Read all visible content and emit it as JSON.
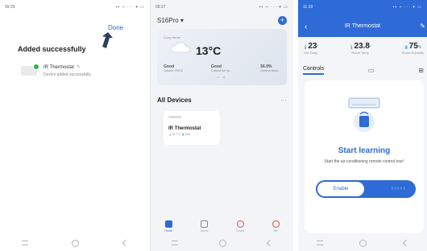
{
  "screen1": {
    "status_time": "09:29",
    "status_icons": "▪▪ ⌁ ··· ▾ ▭",
    "done_label": "Done",
    "title": "Added successfully",
    "device_name": "IR Thermostat",
    "device_subtitle": "Device added successfully",
    "colors": {
      "link": "#2f6bd6",
      "success": "#2db54a"
    }
  },
  "screen2": {
    "status_time": "09:27",
    "status_icons": "▪▪ ⌁ ··· ▾ ▭",
    "home_name": "S16Pro ▾",
    "weather": {
      "location": "Cozy Home",
      "temperature": "13°C",
      "stats": [
        {
          "value": "Good",
          "label": "Outdoor PM2.5"
        },
        {
          "value": "Good",
          "label": "Outdoor Air Qu..."
        },
        {
          "value": "56.0%",
          "label": "Outdoor Humi..."
        }
      ]
    },
    "all_devices_title": "All Devices",
    "card": {
      "name": "IR Thermostat",
      "stats": "🌡15.7°C  💧43%"
    },
    "tabs": [
      {
        "label": "Home",
        "active": true,
        "color": "#2f6bd6"
      },
      {
        "label": "Scene",
        "active": false,
        "color": "#7a8a9a"
      },
      {
        "label": "Smart",
        "active": false,
        "color": "#e04848"
      },
      {
        "label": "Me",
        "active": false,
        "color": "#e04848"
      }
    ]
  },
  "screen3": {
    "status_time": "11:19",
    "status_icons": "▪▪ ⌁ ··· ▾ ▭",
    "title": "IR Thermostat",
    "readings": [
      {
        "value": "23",
        "unit": "°",
        "label": "Out Temp"
      },
      {
        "value": "23.8",
        "unit": "°",
        "label": "Room Temp"
      },
      {
        "value": "75",
        "unit": "%",
        "label": "Room Humidity"
      }
    ],
    "tab_controls": "Controls",
    "learn_title": "Start learning",
    "learn_subtitle": "Start the air-conditioning remote control tour!",
    "enable_label": "Enable",
    "colors": {
      "accent": "#2f6bd6"
    }
  }
}
